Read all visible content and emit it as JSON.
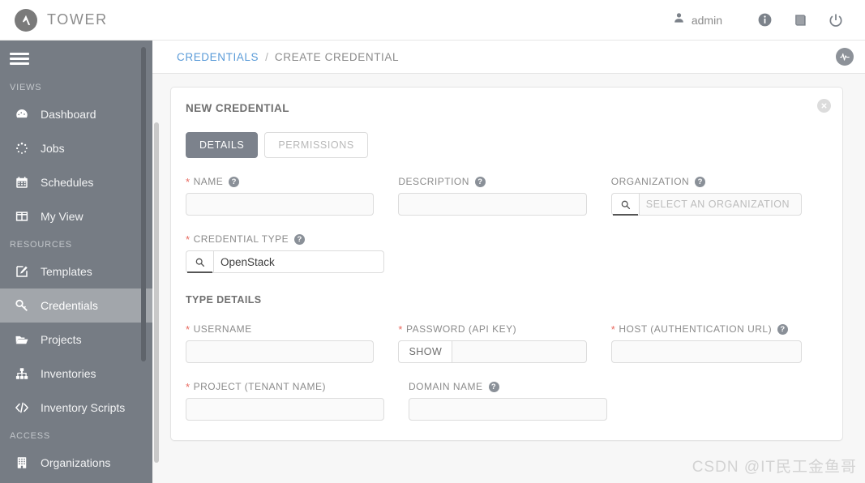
{
  "header": {
    "brand_name": "TOWER",
    "user_name": "admin",
    "user_icon": "user-icon",
    "info_icon": "info-icon",
    "docs_icon": "book-icon",
    "logout_icon": "power-icon"
  },
  "sidebar": {
    "menu_icon": "hamburger-icon",
    "sections": [
      {
        "title": "VIEWS",
        "items": [
          {
            "label": "Dashboard",
            "icon": "dashboard-icon",
            "active": false
          },
          {
            "label": "Jobs",
            "icon": "jobs-spinner-icon",
            "active": false
          },
          {
            "label": "Schedules",
            "icon": "calendar-icon",
            "active": false
          },
          {
            "label": "My View",
            "icon": "columns-icon",
            "active": false
          }
        ]
      },
      {
        "title": "RESOURCES",
        "items": [
          {
            "label": "Templates",
            "icon": "pencil-square-icon",
            "active": false
          },
          {
            "label": "Credentials",
            "icon": "key-icon",
            "active": true
          },
          {
            "label": "Projects",
            "icon": "folder-icon",
            "active": false
          },
          {
            "label": "Inventories",
            "icon": "sitemap-icon",
            "active": false
          },
          {
            "label": "Inventory Scripts",
            "icon": "code-icon",
            "active": false
          }
        ]
      },
      {
        "title": "ACCESS",
        "items": [
          {
            "label": "Organizations",
            "icon": "building-icon",
            "active": false
          }
        ]
      }
    ]
  },
  "breadcrumb": {
    "parent": "CREDENTIALS",
    "separator": "/",
    "current": "CREATE CREDENTIAL",
    "activity_icon": "activity-stream-icon"
  },
  "card": {
    "title": "NEW CREDENTIAL",
    "close_icon": "close-icon",
    "tabs": [
      {
        "label": "DETAILS",
        "active": true
      },
      {
        "label": "PERMISSIONS",
        "active": false
      }
    ],
    "fields": {
      "name": {
        "label": "NAME",
        "required": true,
        "help": true,
        "value": "",
        "placeholder": ""
      },
      "description": {
        "label": "DESCRIPTION",
        "required": false,
        "help": true,
        "value": "",
        "placeholder": ""
      },
      "organization": {
        "label": "ORGANIZATION",
        "required": false,
        "help": true,
        "value": "",
        "placeholder": "SELECT AN ORGANIZATION",
        "search_icon": "search-icon"
      },
      "credential_type": {
        "label": "CREDENTIAL TYPE",
        "required": true,
        "help": true,
        "value": "OpenStack",
        "search_icon": "search-icon"
      },
      "username": {
        "label": "USERNAME",
        "required": true,
        "help": false,
        "value": ""
      },
      "password": {
        "label": "PASSWORD (API KEY)",
        "required": true,
        "help": false,
        "value": "",
        "show_label": "SHOW"
      },
      "host": {
        "label": "HOST (AUTHENTICATION URL)",
        "required": true,
        "help": true,
        "value": ""
      },
      "project": {
        "label": "PROJECT (TENANT NAME)",
        "required": true,
        "help": false,
        "value": ""
      },
      "domain": {
        "label": "DOMAIN NAME",
        "required": false,
        "help": true,
        "value": ""
      }
    },
    "section_heading": "TYPE DETAILS"
  },
  "watermark": "CSDN @IT民工金鱼哥",
  "colors": {
    "sidebar_bg": "#767c84",
    "sidebar_active": "#a2a6ab",
    "link_blue": "#5a9bd8",
    "required_red": "#e8695f",
    "page_bg": "#f7f7f7",
    "tab_active_bg": "#7c828c"
  }
}
